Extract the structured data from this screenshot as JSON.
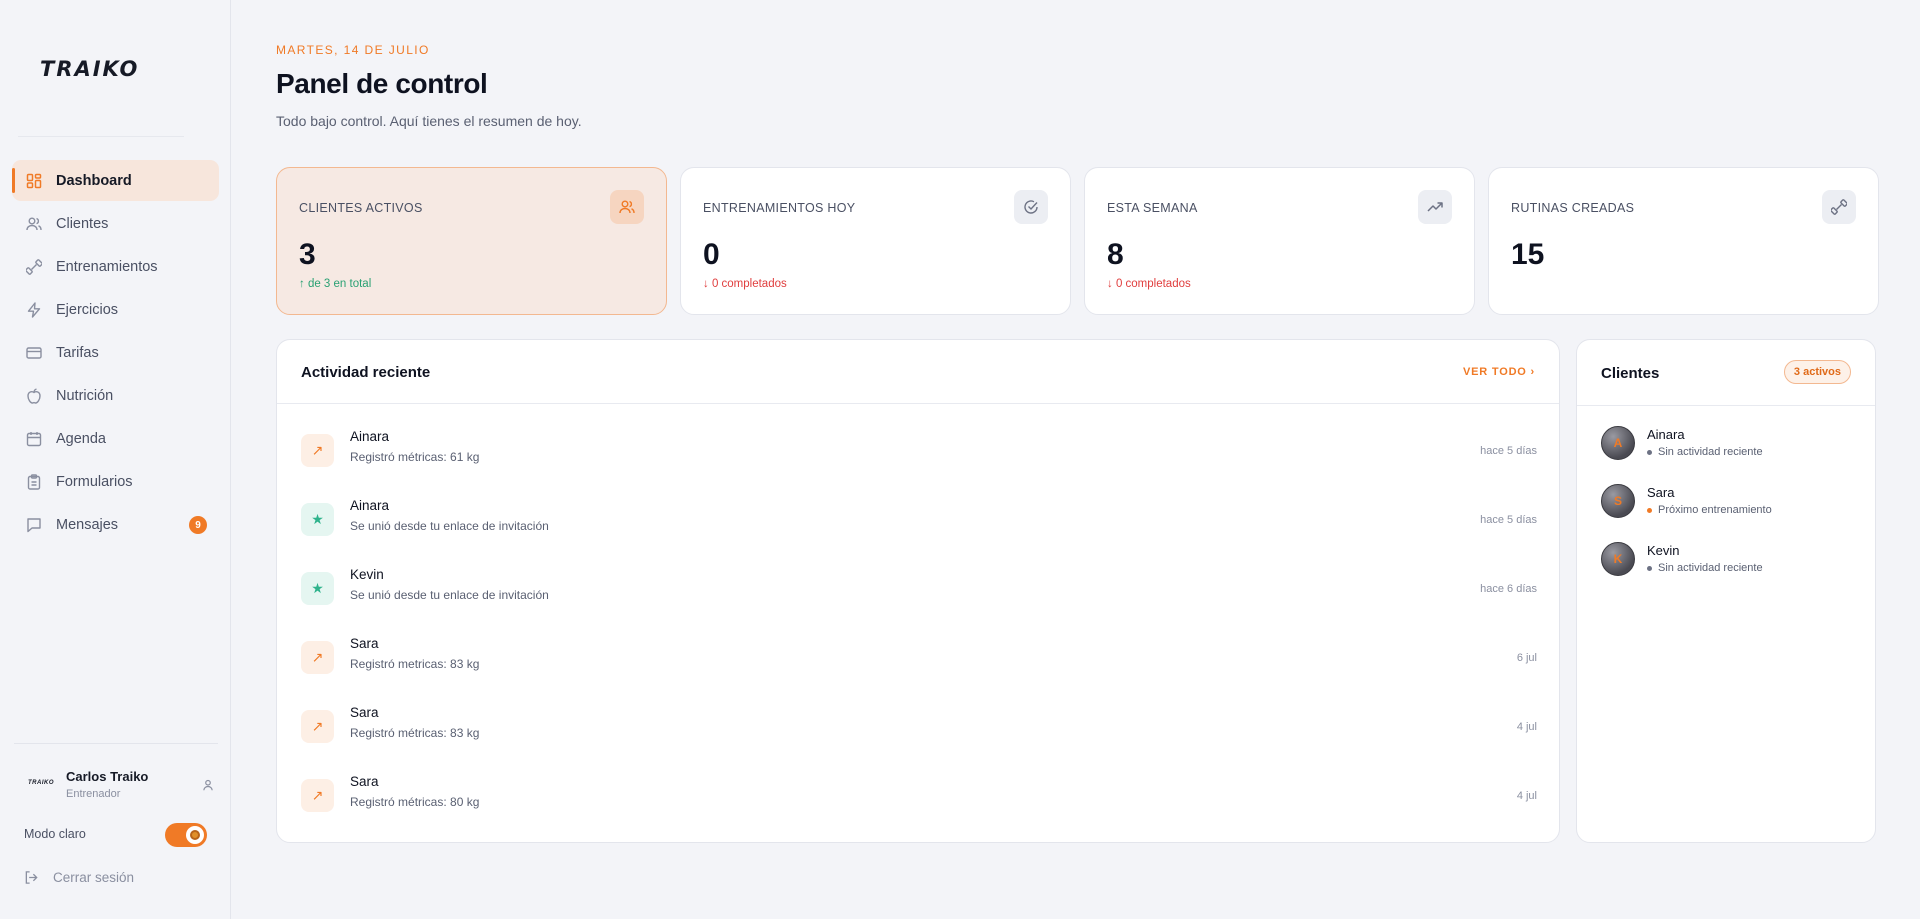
{
  "sidebar": {
    "logo": "TRAIKO",
    "items": [
      {
        "label": "Dashboard",
        "icon": "grid-icon",
        "active": true
      },
      {
        "label": "Clientes",
        "icon": "users-icon"
      },
      {
        "label": "Entrenamientos",
        "icon": "dumbbell-icon"
      },
      {
        "label": "Ejercicios",
        "icon": "bolt-icon"
      },
      {
        "label": "Tarifas",
        "icon": "credit-card-icon"
      },
      {
        "label": "Nutrición",
        "icon": "apple-icon"
      },
      {
        "label": "Agenda",
        "icon": "calendar-icon"
      },
      {
        "label": "Formularios",
        "icon": "clipboard-icon"
      },
      {
        "label": "Mensajes",
        "icon": "message-icon",
        "badge": "9"
      }
    ],
    "user": {
      "mini_logo": "TRAIKO",
      "name": "Carlos Traiko",
      "role": "Entrenador"
    },
    "mode_label": "Modo claro",
    "logout_label": "Cerrar sesión"
  },
  "header": {
    "date": "MARTES, 14 DE JULIO",
    "title": "Panel de control",
    "subtitle": "Todo bajo control. Aquí tienes el resumen de hoy."
  },
  "stats": [
    {
      "label": "CLIENTES ACTIVOS",
      "value": "3",
      "note": "↑ de 3 en total",
      "trend": "up",
      "icon": "users-icon"
    },
    {
      "label": "ENTRENAMIENTOS HOY",
      "value": "0",
      "note": "↓ 0 completados",
      "trend": "down",
      "icon": "check-circle-icon"
    },
    {
      "label": "ESTA SEMANA",
      "value": "8",
      "note": "↓ 0 completados",
      "trend": "down",
      "icon": "trend-up-icon"
    },
    {
      "label": "RUTINAS CREADAS",
      "value": "15",
      "note": "",
      "icon": "dumbbell-icon"
    }
  ],
  "activity": {
    "title": "Actividad reciente",
    "link": "VER TODO",
    "rows": [
      {
        "name": "Ainara",
        "desc": "Registró métricas: 61 kg",
        "time": "hace 5 días",
        "kind": "metric"
      },
      {
        "name": "Ainara",
        "desc": "Se unió desde tu enlace de invitación",
        "time": "hace 5 días",
        "kind": "star"
      },
      {
        "name": "Kevin",
        "desc": "Se unió desde tu enlace de invitación",
        "time": "hace 6 días",
        "kind": "star"
      },
      {
        "name": "Sara",
        "desc": "Registró metricas: 83 kg",
        "time": "6 jul",
        "kind": "metric"
      },
      {
        "name": "Sara",
        "desc": "Registró métricas: 83 kg",
        "time": "4 jul",
        "kind": "metric"
      },
      {
        "name": "Sara",
        "desc": "Registró métricas: 80 kg",
        "time": "4 jul",
        "kind": "metric"
      }
    ]
  },
  "clients": {
    "title": "Clientes",
    "pill": "3 activos",
    "items": [
      {
        "initial": "A",
        "name": "Ainara",
        "status": "Sin actividad reciente",
        "dot_color": "#6d7284"
      },
      {
        "initial": "S",
        "name": "Sara",
        "status": "Próximo entrenamiento",
        "dot_color": "#f07a26"
      },
      {
        "initial": "K",
        "name": "Kevin",
        "status": "Sin actividad reciente",
        "dot_color": "#6d7284"
      }
    ]
  },
  "colors": {
    "accent": "#f07a26",
    "up": "#2aa173",
    "down": "#e03e3e"
  }
}
